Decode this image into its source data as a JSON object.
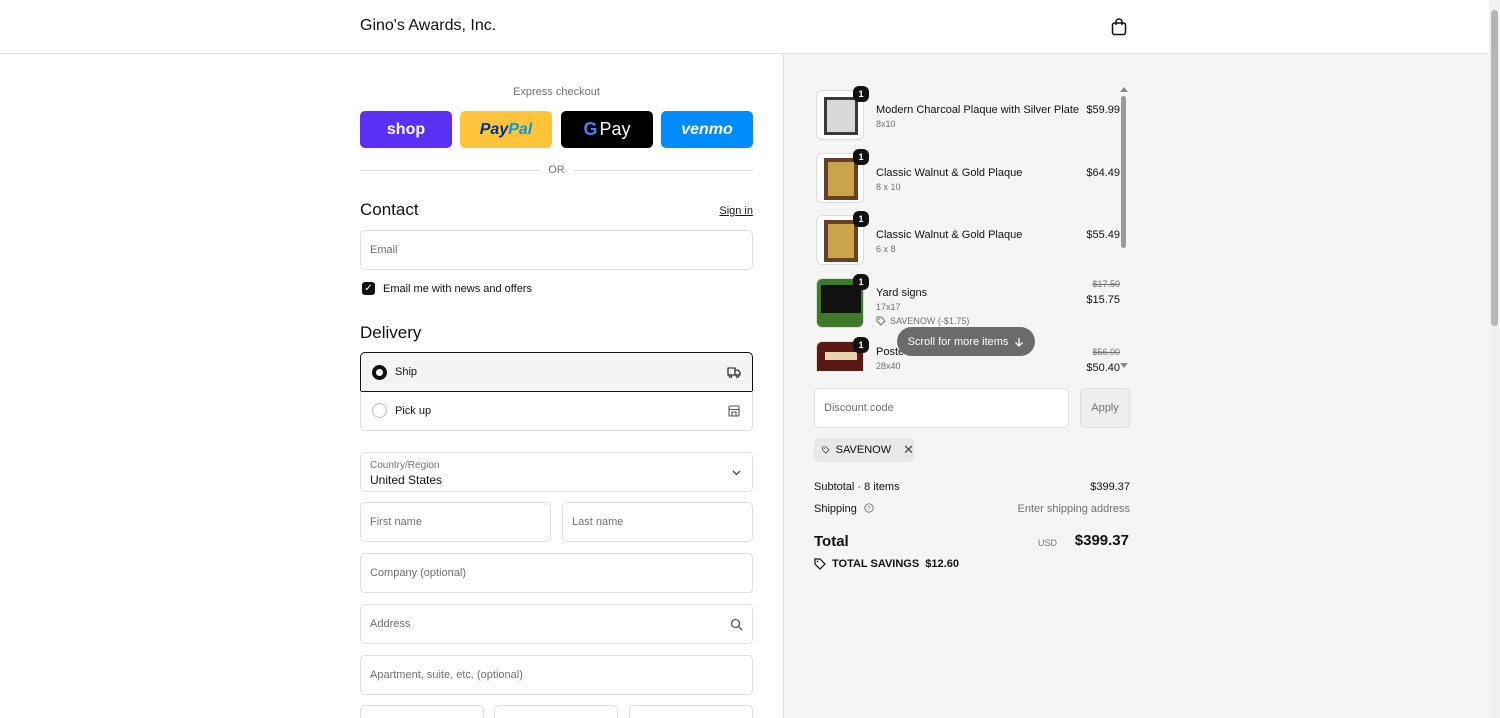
{
  "header": {
    "brand": "Gino's Awards, Inc.",
    "cart_icon": "shopping-bag-icon"
  },
  "express": {
    "label": "Express checkout",
    "buttons": [
      {
        "name": "shop",
        "label": "shop"
      },
      {
        "name": "paypal",
        "label_a": "Pay",
        "label_b": "Pal"
      },
      {
        "name": "gpay",
        "label_g": "G",
        "label": "Pay"
      },
      {
        "name": "venmo",
        "label": "venmo"
      }
    ],
    "or": "OR"
  },
  "contact": {
    "title": "Contact",
    "sign_in": "Sign in",
    "email_placeholder": "Email",
    "newsletter_label": "Email me with news and offers",
    "newsletter_checked": true
  },
  "delivery": {
    "title": "Delivery",
    "options": [
      {
        "label": "Ship",
        "selected": true,
        "icon": "truck-icon"
      },
      {
        "label": "Pick up",
        "selected": false,
        "icon": "store-icon"
      }
    ],
    "country_label": "Country/Region",
    "country_value": "United States",
    "first_name": "First name",
    "last_name": "Last name",
    "company": "Company (optional)",
    "address": "Address",
    "apartment": "Apartment, suite, etc. (optional)"
  },
  "order": {
    "items": [
      {
        "qty": "1",
        "name": "Modern Charcoal Plaque with Silver Plate",
        "variant": "8x10",
        "price": "$59.99"
      },
      {
        "qty": "1",
        "name": "Classic Walnut & Gold Plaque",
        "variant": "8 x 10",
        "price": "$64.49"
      },
      {
        "qty": "1",
        "name": "Classic Walnut & Gold Plaque",
        "variant": "6 x 8",
        "price": "$55.49"
      },
      {
        "qty": "1",
        "name": "Yard signs",
        "variant": "17x17",
        "price_old": "$17.50",
        "price": "$15.75",
        "discount": "SAVENOW (-$1.75)"
      },
      {
        "qty": "1",
        "name": "Poste",
        "variant": "28x40",
        "price_old": "$56.00",
        "price": "$50.40"
      }
    ],
    "scroll_hint": "Scroll for more items",
    "discount_placeholder": "Discount code",
    "apply": "Apply",
    "applied_code": "SAVENOW",
    "subtotal_label": "Subtotal · 8 items",
    "subtotal": "$399.37",
    "shipping_label": "Shipping",
    "shipping_value": "Enter shipping address",
    "total_label": "Total",
    "currency": "USD",
    "total": "$399.37",
    "savings": "TOTAL SAVINGS  $12.60"
  },
  "colors": {
    "shop": "#5a31f4",
    "paypal": "#ffc439",
    "gpay": "#000000",
    "venmo": "#008cff"
  }
}
